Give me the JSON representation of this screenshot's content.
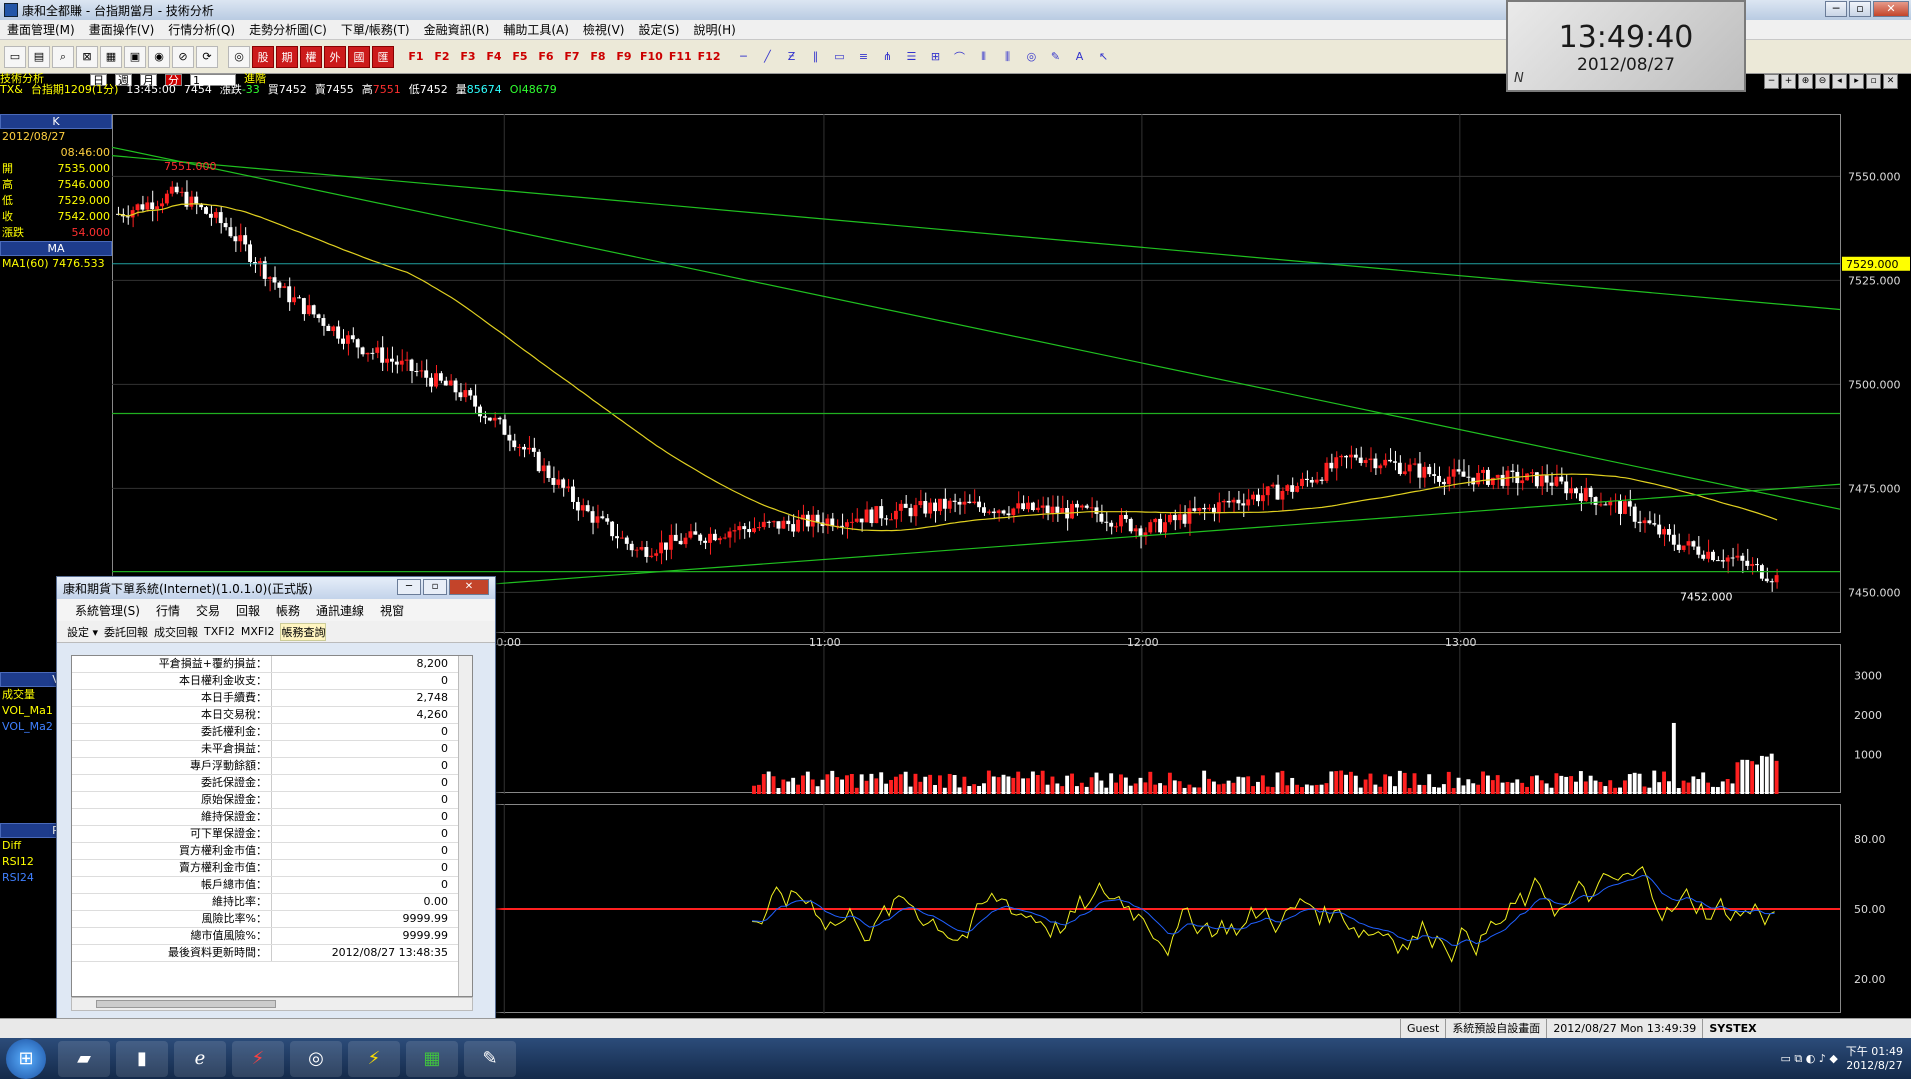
{
  "window": {
    "title": "康和全都賺 - 台指期當月 - 技術分析",
    "btn_min": "─",
    "btn_max": "▫",
    "btn_close": "✕"
  },
  "menu": [
    "畫面管理(M)",
    "畫面操作(V)",
    "行情分析(Q)",
    "走勢分析圖(C)",
    "下單/帳務(T)",
    "金融資訊(R)",
    "輔助工具(A)",
    "檢視(V)",
    "設定(S)",
    "說明(H)"
  ],
  "toolbar": {
    "buttons": [
      "股",
      "期",
      "權",
      "外",
      "國",
      "匯"
    ],
    "fkeys": [
      "F1",
      "F2",
      "F3",
      "F4",
      "F5",
      "F6",
      "F7",
      "F8",
      "F9",
      "F10",
      "F11",
      "F12"
    ]
  },
  "clock": {
    "time": "13:49:40",
    "date": "2012/08/27",
    "mark": "N"
  },
  "info": {
    "section": "技術分析",
    "period": [
      "日",
      "週",
      "月",
      "分"
    ],
    "interval": "1",
    "advanced": "進階",
    "symbol": "TX&",
    "name": "台指期1209(1分)",
    "time": "13:45:00",
    "last": "7454",
    "change_label": "漲跌",
    "change": "-33",
    "buy_label": "買",
    "buy": "7452",
    "sell_label": "賣",
    "sell": "7455",
    "high_label": "高",
    "high": "7551",
    "low_label": "低",
    "low": "7452",
    "vol_label": "量",
    "vol": "85674",
    "oi_label": "OI",
    "oi": "48679"
  },
  "left": {
    "k_title": "K",
    "date": "2012/08/27",
    "time": "08:46:00",
    "rows": [
      {
        "k": "開",
        "v": "7535.000"
      },
      {
        "k": "高",
        "v": "7546.000"
      },
      {
        "k": "低",
        "v": "7529.000"
      },
      {
        "k": "收",
        "v": "7542.000"
      },
      {
        "k": "漲跌",
        "v": "54.000"
      }
    ],
    "ma_title": "MA",
    "ma_value": "MA1(60) 7476.533",
    "vol_title": "V",
    "vol_items": [
      "成交量",
      "VOL_Ma1",
      "VOL_Ma2"
    ],
    "rsi_title": "R",
    "rsi_items": [
      "Diff",
      "RSI12",
      "RSI24"
    ]
  },
  "chart_data": {
    "type": "candlestick",
    "time_labels": [
      "10:00",
      "11:00",
      "12:00",
      "13:00"
    ],
    "price_ticks": [
      "7550.000",
      "7525.000",
      "7500.000",
      "7475.000",
      "7450.000"
    ],
    "price_range": [
      7440,
      7565
    ],
    "high_label": "7551.000",
    "low_label": "7452.000",
    "current_marker": "7529.000",
    "volume_ticks": [
      "3000",
      "2000",
      "1000"
    ],
    "volume_range": [
      0,
      3800
    ],
    "rsi_ticks": [
      "80.00",
      "50.00",
      "20.00"
    ],
    "rsi_range": [
      5,
      95
    ],
    "colors": {
      "up": "#ff2020",
      "down": "#ffffff",
      "ma": "#e0d020",
      "trend": "#20c020",
      "level": "#20b020",
      "rsi12": "#f0f020",
      "rsi24": "#2060ff"
    }
  },
  "dialog": {
    "title": "康和期貨下單系統(Internet)(1.0.1.0)(正式版)",
    "menu": [
      "系統管理(S)",
      "行情",
      "交易",
      "回報",
      "帳務",
      "通訊連線",
      "視窗"
    ],
    "toolbar": [
      "設定 ▾",
      "委託回報",
      "成交回報",
      "TXFI2",
      "MXFI2",
      "帳務查詢"
    ],
    "rows": [
      {
        "k": "平倉損益+覆約損益：",
        "v": "8,200"
      },
      {
        "k": "本日權利金收支：",
        "v": "0"
      },
      {
        "k": "本日手續費：",
        "v": "2,748"
      },
      {
        "k": "本日交易稅：",
        "v": "4,260"
      },
      {
        "k": "委託權利金：",
        "v": "0"
      },
      {
        "k": "未平倉損益：",
        "v": "0"
      },
      {
        "k": "專戶浮動餘額：",
        "v": "0"
      },
      {
        "k": "委託保證金：",
        "v": "0"
      },
      {
        "k": "原始保證金：",
        "v": "0"
      },
      {
        "k": "維持保證金：",
        "v": "0"
      },
      {
        "k": "可下單保證金：",
        "v": "0"
      },
      {
        "k": "買方權利金市值：",
        "v": "0"
      },
      {
        "k": "賣方權利金市值：",
        "v": "0"
      },
      {
        "k": "帳戶總市值：",
        "v": "0"
      },
      {
        "k": "維持比率：",
        "v": "0.00"
      },
      {
        "k": "風險比率%：",
        "v": "9999.99"
      },
      {
        "k": "總市值風險%：",
        "v": "9999.99"
      },
      {
        "k": "最後資料更新時間：",
        "v": "2012/08/27 13:48:35"
      }
    ]
  },
  "status": {
    "user": "Guest",
    "layout": "系統預設自設畫面",
    "datetime": "2012/08/27 Mon 13:49:39",
    "brand": "SYSTEX"
  },
  "taskbar": {
    "time": "下午 01:49",
    "date": "2012/8/27"
  }
}
